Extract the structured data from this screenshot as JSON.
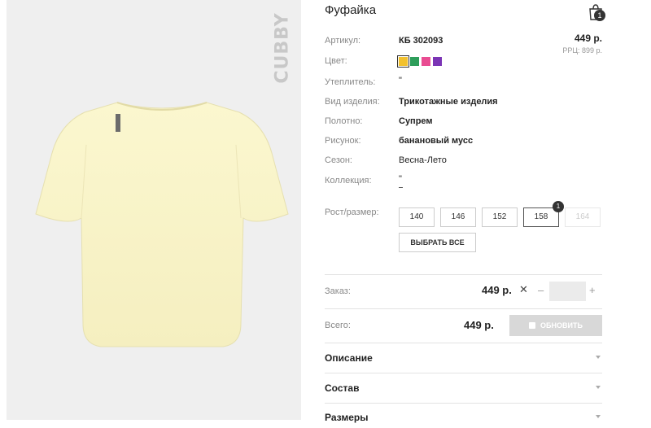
{
  "brand_logo_text": "CUBBY",
  "product": {
    "title": "Фуфайка",
    "cart_count": "1",
    "price": "449 р.",
    "rrc": "РРЦ: 899 р."
  },
  "specs": [
    {
      "label": "Артикул:",
      "value": "КБ 302093"
    },
    {
      "label": "Цвет:",
      "value": ""
    },
    {
      "label": "Утеплитель:",
      "value": "\""
    },
    {
      "label": "Вид изделия:",
      "value": "Трикотажные изделия"
    },
    {
      "label": "Полотно:",
      "value": "Супрем"
    },
    {
      "label": "Рисунок:",
      "value": "банановый мусс"
    },
    {
      "label": "Сезон:",
      "value": "Весна-Лето"
    },
    {
      "label": "Коллекция:",
      "value": "\""
    }
  ],
  "colors": [
    {
      "hex": "#f2c12e",
      "selected": true
    },
    {
      "hex": "#2e9e5b",
      "selected": false
    },
    {
      "hex": "#e94c92",
      "selected": false
    },
    {
      "hex": "#7b35b5",
      "selected": false
    }
  ],
  "size_label": "Рост/размер:",
  "sizes": [
    {
      "label": "140",
      "state": "normal"
    },
    {
      "label": "146",
      "state": "normal"
    },
    {
      "label": "152",
      "state": "normal"
    },
    {
      "label": "158",
      "state": "selected",
      "badge": "1"
    },
    {
      "label": "164",
      "state": "disabled"
    }
  ],
  "select_all": "ВЫБРАТЬ ВСЕ",
  "order": {
    "label": "Заказ:",
    "price": "449 р.",
    "times": "✕",
    "minus": "–",
    "plus": "+",
    "qty_value": ""
  },
  "total": {
    "label": "Всего:",
    "price": "449 р.",
    "update_label": "ОБНОВИТЬ"
  },
  "accordions": [
    {
      "title": "Описание"
    },
    {
      "title": "Состав"
    },
    {
      "title": "Размеры"
    }
  ]
}
